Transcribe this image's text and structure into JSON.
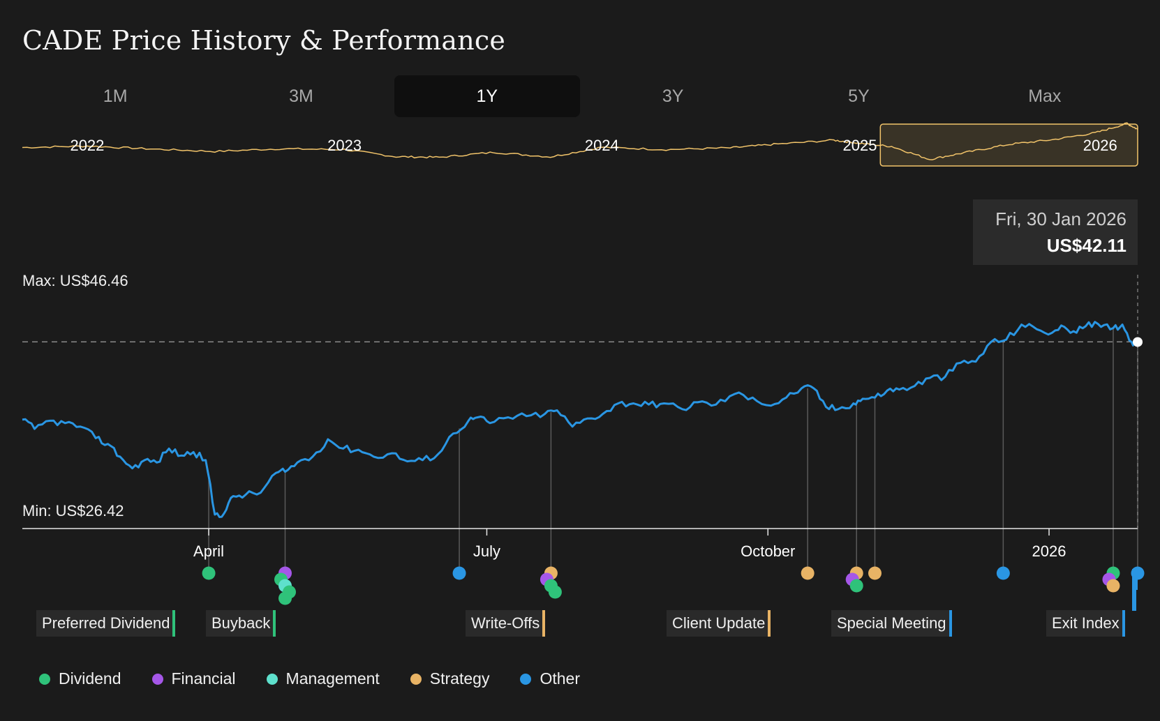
{
  "title": "CADE Price History & Performance",
  "tabs": [
    {
      "label": "1M",
      "active": false
    },
    {
      "label": "3M",
      "active": false
    },
    {
      "label": "1Y",
      "active": true
    },
    {
      "label": "3Y",
      "active": false
    },
    {
      "label": "5Y",
      "active": false
    },
    {
      "label": "Max",
      "active": false
    }
  ],
  "colors": {
    "background": "#1b1b1b",
    "price_line": "#2a96e3",
    "overview_line": "#f2c46a",
    "Dividend": "#2fc27a",
    "Financial": "#a557e8",
    "Management": "#5ee0cc",
    "Strategy": "#e8b365",
    "Other": "#2a96e3"
  },
  "tooltip": {
    "date": "Fri, 30 Jan 2026",
    "price": "US$42.11"
  },
  "max_label": "Max: US$46.46",
  "min_label": "Min: US$26.42",
  "legend": [
    {
      "name": "Dividend",
      "color": "#2fc27a"
    },
    {
      "name": "Financial",
      "color": "#a557e8"
    },
    {
      "name": "Management",
      "color": "#5ee0cc"
    },
    {
      "name": "Strategy",
      "color": "#e8b365"
    },
    {
      "name": "Other",
      "color": "#2a96e3"
    }
  ],
  "event_labels": [
    {
      "text": "Preferred Dividend",
      "category": "Dividend",
      "date": "2025-04-01"
    },
    {
      "text": "Buyback",
      "category": "Dividend",
      "date": "2025-04-26"
    },
    {
      "text": "Write-Offs",
      "category": "Strategy",
      "date": "2025-07-22"
    },
    {
      "text": "Client Update",
      "category": "Strategy",
      "date": "2025-10-14"
    },
    {
      "text": "Special Meeting",
      "category": "Other",
      "date": "2025-12-17"
    },
    {
      "text": "Exit Index",
      "category": "Other",
      "date": "2026-01-30"
    }
  ],
  "chart_data": [
    {
      "type": "line",
      "name": "overview",
      "x_ticks": [
        "2022",
        "2023",
        "2024",
        "2025",
        "2026"
      ],
      "x_tick_dates": [
        "2022-01-01",
        "2023-01-01",
        "2024-01-01",
        "2025-01-01",
        "2026-01-01"
      ],
      "range": [
        "2021-10-01",
        "2026-01-30"
      ],
      "selected_range": [
        "2025-01-30",
        "2026-01-30"
      ],
      "x": [
        "2021-10-01",
        "2022-01-01",
        "2022-04-01",
        "2022-07-01",
        "2022-10-01",
        "2023-01-01",
        "2023-03-15",
        "2023-05-15",
        "2023-08-01",
        "2023-10-20",
        "2024-01-01",
        "2024-04-01",
        "2024-07-01",
        "2024-09-01",
        "2024-11-25",
        "2025-01-01",
        "2025-02-15",
        "2025-04-10",
        "2025-06-01",
        "2025-08-01",
        "2025-10-01",
        "2025-12-01",
        "2026-01-15",
        "2026-01-30"
      ],
      "y": [
        33.5,
        34.2,
        32.8,
        31.6,
        32.9,
        32.5,
        29.1,
        28.8,
        31.2,
        29.0,
        33.6,
        32.5,
        33.3,
        35.0,
        37.0,
        35.5,
        34.0,
        27.8,
        31.2,
        35.0,
        37.2,
        40.5,
        45.0,
        42.1
      ]
    },
    {
      "type": "line",
      "name": "price",
      "title": "",
      "xlabel": "",
      "ylabel": "",
      "x_ticks": [
        "April",
        "July",
        "October",
        "2026"
      ],
      "x_tick_dates": [
        "2025-04-01",
        "2025-07-01",
        "2025-10-01",
        "2026-01-01"
      ],
      "x_range": [
        "2025-01-30",
        "2026-01-30"
      ],
      "ylim": [
        26.42,
        46.46
      ],
      "max": 46.46,
      "min": 26.42,
      "reference_line": 42.11,
      "x": [
        "2025-01-30",
        "2025-02-03",
        "2025-02-08",
        "2025-02-13",
        "2025-02-18",
        "2025-02-23",
        "2025-02-27",
        "2025-03-03",
        "2025-03-07",
        "2025-03-11",
        "2025-03-15",
        "2025-03-19",
        "2025-03-23",
        "2025-03-27",
        "2025-03-31",
        "2025-04-03",
        "2025-04-06",
        "2025-04-09",
        "2025-04-13",
        "2025-04-18",
        "2025-04-23",
        "2025-04-26",
        "2025-04-30",
        "2025-05-05",
        "2025-05-10",
        "2025-05-15",
        "2025-05-20",
        "2025-05-25",
        "2025-05-31",
        "2025-06-05",
        "2025-06-10",
        "2025-06-15",
        "2025-06-20",
        "2025-06-25",
        "2025-06-28",
        "2025-07-02",
        "2025-07-08",
        "2025-07-14",
        "2025-07-20",
        "2025-07-24",
        "2025-07-29",
        "2025-08-03",
        "2025-08-08",
        "2025-08-13",
        "2025-08-18",
        "2025-08-23",
        "2025-08-28",
        "2025-09-03",
        "2025-09-08",
        "2025-09-14",
        "2025-09-20",
        "2025-09-26",
        "2025-10-02",
        "2025-10-07",
        "2025-10-12",
        "2025-10-16",
        "2025-10-20",
        "2025-10-24",
        "2025-10-29",
        "2025-11-01",
        "2025-11-05",
        "2025-11-09",
        "2025-11-13",
        "2025-11-18",
        "2025-11-23",
        "2025-11-28",
        "2025-12-03",
        "2025-12-08",
        "2025-12-13",
        "2025-12-18",
        "2025-12-23",
        "2025-12-28",
        "2026-01-02",
        "2026-01-06",
        "2026-01-10",
        "2026-01-14",
        "2026-01-18",
        "2026-01-22",
        "2026-01-25",
        "2026-01-28",
        "2026-01-30"
      ],
      "y": [
        35.4,
        34.6,
        35.3,
        35.1,
        34.8,
        33.8,
        33.3,
        32.2,
        31.2,
        31.9,
        31.7,
        32.9,
        32.3,
        32.6,
        31.9,
        27.2,
        27.3,
        28.8,
        28.9,
        29.1,
        30.8,
        30.9,
        31.7,
        32.2,
        33.7,
        32.9,
        32.8,
        32.2,
        32.5,
        31.8,
        31.9,
        32.4,
        34.2,
        35.3,
        35.6,
        35.1,
        35.6,
        35.7,
        35.9,
        36.2,
        34.8,
        35.5,
        35.9,
        36.8,
        36.8,
        36.7,
        36.8,
        36.3,
        36.9,
        36.7,
        37.6,
        37.3,
        36.6,
        37.3,
        38.1,
        38.1,
        36.5,
        36.3,
        36.8,
        37.2,
        37.3,
        37.9,
        38.0,
        38.3,
        39.0,
        39.1,
        40.3,
        40.4,
        42.1,
        42.3,
        43.6,
        43.2,
        42.9,
        43.4,
        42.9,
        43.8,
        43.4,
        43.3,
        43.6,
        42.1,
        42.1
      ]
    }
  ],
  "events": [
    {
      "date": "2025-04-01",
      "category": "Dividend"
    },
    {
      "date": "2025-04-26",
      "category": "Financial"
    },
    {
      "date": "2025-04-26",
      "category": "Dividend"
    },
    {
      "date": "2025-04-26",
      "category": "Management"
    },
    {
      "date": "2025-04-26",
      "category": "Dividend"
    },
    {
      "date": "2025-04-26",
      "category": "Dividend"
    },
    {
      "date": "2025-06-22",
      "category": "Other"
    },
    {
      "date": "2025-07-22",
      "category": "Strategy"
    },
    {
      "date": "2025-07-22",
      "category": "Financial"
    },
    {
      "date": "2025-07-22",
      "category": "Dividend"
    },
    {
      "date": "2025-07-22",
      "category": "Dividend"
    },
    {
      "date": "2025-10-14",
      "category": "Strategy"
    },
    {
      "date": "2025-10-30",
      "category": "Strategy"
    },
    {
      "date": "2025-10-30",
      "category": "Financial"
    },
    {
      "date": "2025-10-30",
      "category": "Dividend"
    },
    {
      "date": "2025-11-05",
      "category": "Strategy"
    },
    {
      "date": "2025-12-17",
      "category": "Other"
    },
    {
      "date": "2026-01-22",
      "category": "Dividend"
    },
    {
      "date": "2026-01-22",
      "category": "Financial"
    },
    {
      "date": "2026-01-22",
      "category": "Strategy"
    },
    {
      "date": "2026-01-30",
      "category": "Other"
    }
  ]
}
